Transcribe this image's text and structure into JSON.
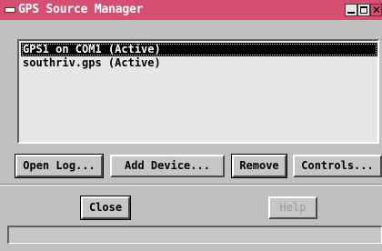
{
  "window": {
    "title": "GPS Source Manager",
    "colors": {
      "titlebar": "#d44f72",
      "face": "#c0c0c0",
      "list_bg": "#e6e6e6",
      "selection": "#000000"
    },
    "controls": {
      "minimize_icon": "minimize-icon",
      "maximize_icon": "maximize-icon",
      "close_icon": "close-icon",
      "close_glyph": "✕"
    }
  },
  "sources": {
    "items": [
      {
        "label": "GPS1 on COM1 (Active)",
        "selected": true
      },
      {
        "label": "southriv.gps (Active)",
        "selected": false
      }
    ]
  },
  "toolbar": {
    "open_log": "Open Log...",
    "add_device": "Add Device...",
    "remove": "Remove",
    "controls": "Controls..."
  },
  "footer": {
    "close": "Close",
    "help": "Help",
    "status": ""
  }
}
